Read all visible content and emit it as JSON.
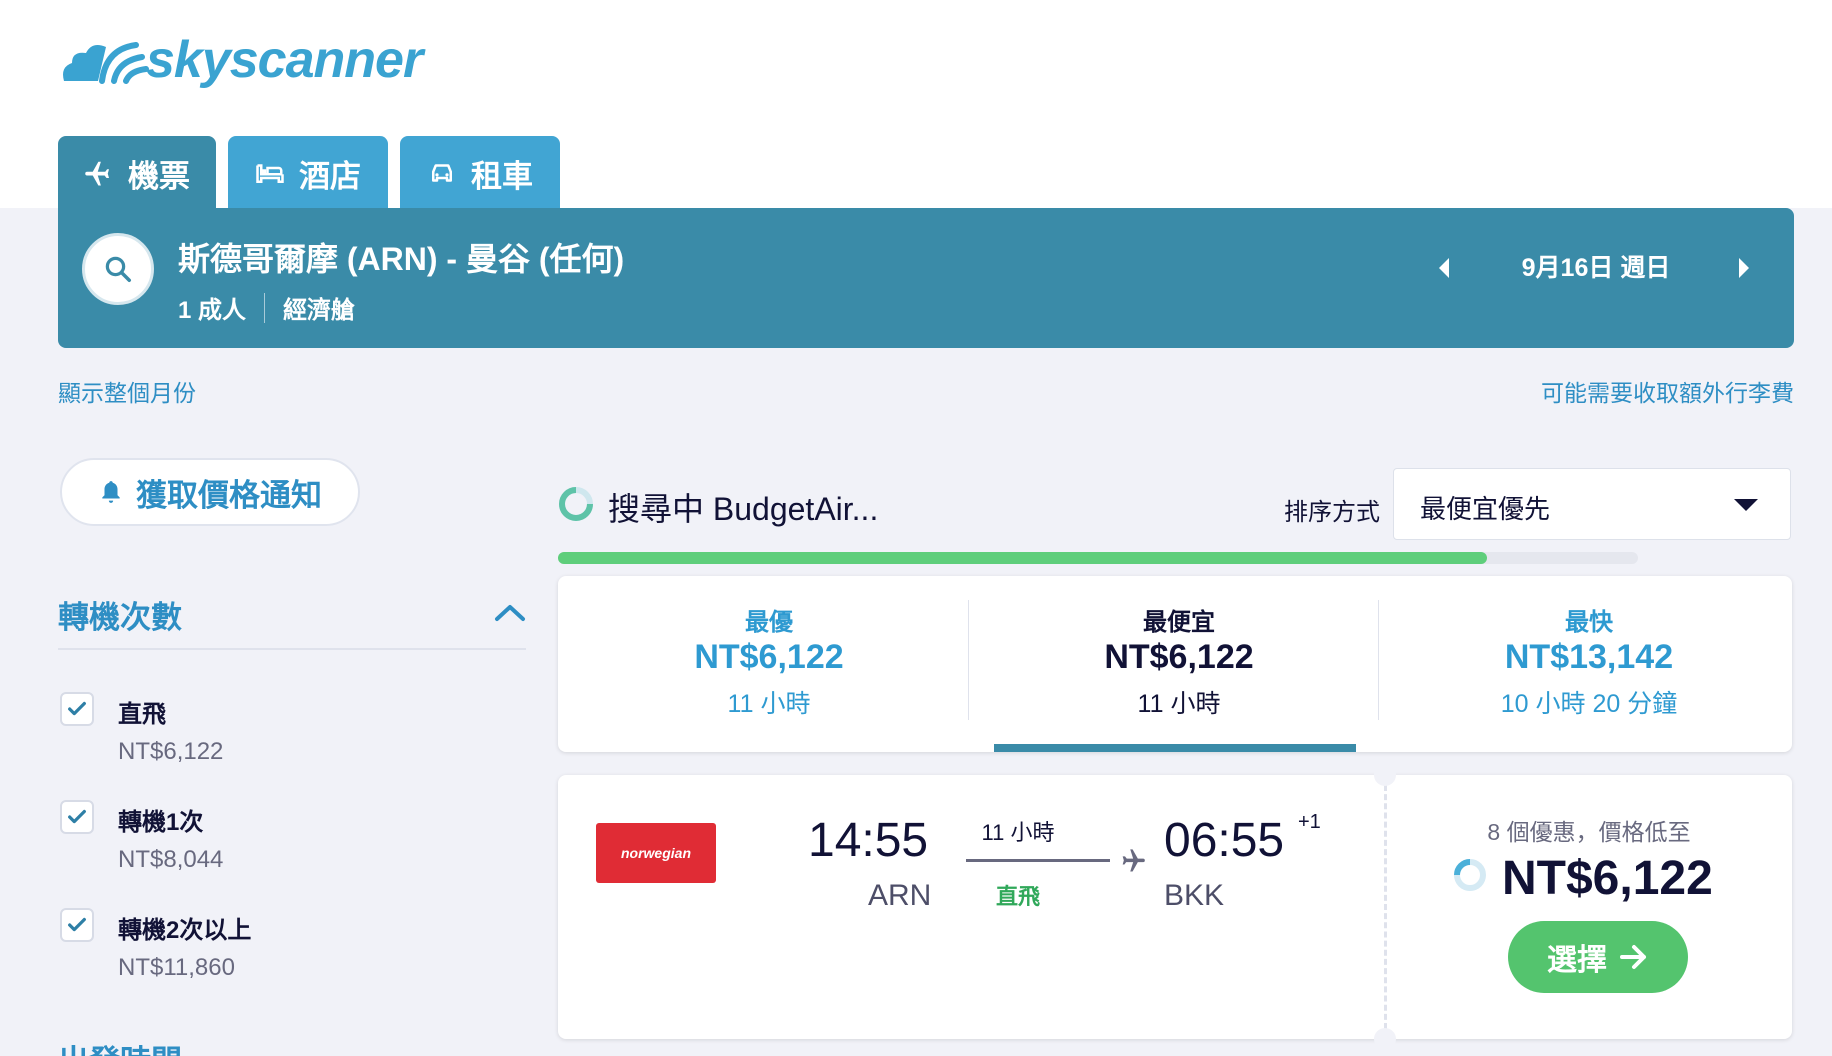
{
  "brand": {
    "name": "skyscanner",
    "color": "#3aa3d1"
  },
  "tabs": [
    {
      "label": "機票",
      "icon": "plane-icon",
      "active": true
    },
    {
      "label": "酒店",
      "icon": "bed-icon",
      "active": false
    },
    {
      "label": "租車",
      "icon": "car-icon",
      "active": false
    }
  ],
  "search": {
    "route": "斯德哥爾摩 (ARN) - 曼谷 (任何)",
    "travellers": "1 成人",
    "cabin": "經濟艙",
    "date": "9月16日 週日"
  },
  "links": {
    "show_month": "顯示整個月份",
    "extra_fees": "可能需要收取額外行李費"
  },
  "price_alert": {
    "label": "獲取價格通知",
    "icon": "bell-icon"
  },
  "filters": {
    "stops_title": "轉機次數",
    "stops": [
      {
        "label": "直飛",
        "price": "NT$6,122",
        "checked": true
      },
      {
        "label": "轉機1次",
        "price": "NT$8,044",
        "checked": true
      },
      {
        "label": "轉機2次以上",
        "price": "NT$11,860",
        "checked": true
      }
    ],
    "departure_title": "出發時間"
  },
  "status": {
    "searching": "搜尋中 BudgetAir...",
    "progress": 0.86
  },
  "sort": {
    "label": "排序方式",
    "value": "最便宜優先"
  },
  "summary": [
    {
      "label": "最優",
      "price": "NT$6,122",
      "duration": "11 小時"
    },
    {
      "label": "最便宜",
      "price": "NT$6,122",
      "duration": "11 小時",
      "selected": true
    },
    {
      "label": "最快",
      "price": "NT$13,142",
      "duration": "10 小時 20 分鐘"
    }
  ],
  "result": {
    "airline": "norwegian",
    "dep_time": "14:55",
    "dep_code": "ARN",
    "duration": "11 小時",
    "stops": "直飛",
    "arr_time": "06:55",
    "arr_day_offset": "+1",
    "arr_code": "BKK",
    "deals": "8 個優惠，價格低至",
    "price": "NT$6,122",
    "select_label": "選擇"
  },
  "colors": {
    "header": "#3a8ba8",
    "tab": "#41a5d3",
    "link": "#2e8ec4",
    "green": "#54c46e",
    "progress": "#5ece7b"
  }
}
